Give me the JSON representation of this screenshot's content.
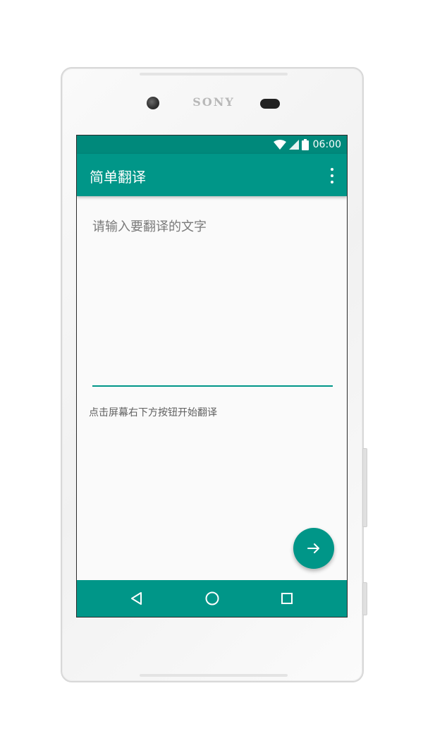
{
  "device": {
    "brand": "SONY"
  },
  "status_bar": {
    "time": "06:00",
    "icons": [
      "wifi-icon",
      "signal-icon",
      "battery-icon"
    ]
  },
  "app_bar": {
    "title": "简单翻译",
    "menu_icon": "more-vert-icon"
  },
  "input": {
    "placeholder": "请输入要翻译的文字",
    "value": ""
  },
  "hint": {
    "text": "点击屏幕右下方按钮开始翻译"
  },
  "fab": {
    "icon": "arrow-forward-icon"
  },
  "nav_bar": {
    "buttons": [
      "back-icon",
      "home-icon",
      "recents-icon"
    ]
  },
  "colors": {
    "primary": "#009688",
    "primary_dark": "#00897b",
    "background": "#fafafa"
  }
}
